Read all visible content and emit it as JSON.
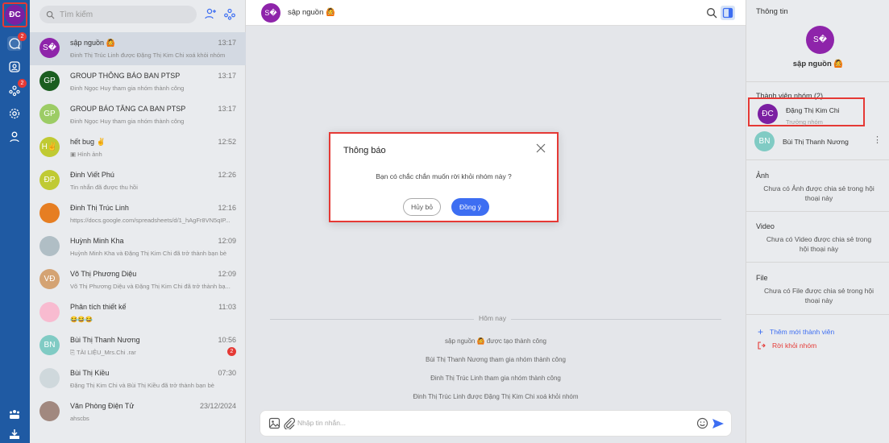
{
  "user": {
    "initials": "ĐC",
    "avatar_color": "#7b1fa2"
  },
  "rail": {
    "items": [
      {
        "name": "messages-icon",
        "badge": "2"
      },
      {
        "name": "contacts-icon",
        "badge": ""
      },
      {
        "name": "groups-icon",
        "badge": "2"
      },
      {
        "name": "settings-icon",
        "badge": ""
      },
      {
        "name": "profile-icon",
        "badge": ""
      }
    ],
    "bottom": [
      "team-icon",
      "download-icon"
    ]
  },
  "search": {
    "placeholder": "Tìm kiếm"
  },
  "conversations": [
    {
      "initials": "S�",
      "color": "#8e24aa",
      "name": "sập nguồn 🙆",
      "time": "13:17",
      "preview": "Đinh Thị Trúc Linh được Đặng Thị Kim Chi xoá khỏi nhóm",
      "selected": true
    },
    {
      "initials": "GP",
      "color": "#1b5e20",
      "name": "GROUP THÔNG BÁO BAN PTSP",
      "time": "13:17",
      "preview": "Đinh Ngọc Huy tham gia nhóm thành công"
    },
    {
      "initials": "GP",
      "color": "#9ccc65",
      "name": "GROUP BÁO TĂNG CA BAN PTSP",
      "time": "13:17",
      "preview": "Đinh Ngọc Huy tham gia nhóm thành công"
    },
    {
      "initials": "H✌",
      "color": "#c0ca33",
      "name": "hết bug ✌",
      "time": "12:52",
      "preview": "Hình ảnh",
      "preview_icon": "image-icon"
    },
    {
      "initials": "ĐP",
      "color": "#c0ca33",
      "name": "Đinh Viết Phú",
      "time": "12:26",
      "preview": "Tin nhắn đã được thu hồi"
    },
    {
      "initials": "",
      "color": "#e67e22",
      "name": "Đinh Thị Trúc Linh",
      "time": "12:16",
      "preview": "https://docs.google.com/spreadsheets/d/1_hAgFr8VN5qIP...",
      "photo": true
    },
    {
      "initials": "",
      "color": "#b0bec5",
      "name": "Huỳnh Minh Kha",
      "time": "12:09",
      "preview": "Huỳnh Minh Kha và Đặng Thị Kim Chi đã trở thành bạn bè",
      "photo": true
    },
    {
      "initials": "VĐ",
      "color": "#d4a373",
      "name": "Võ Thị Phương Diệu",
      "time": "12:09",
      "preview": "Võ Thị Phương Diệu và Đặng Thị Kim Chi đã trở thành bạ..."
    },
    {
      "initials": "",
      "color": "#f8bbd0",
      "name": "Phân tích thiết kế",
      "time": "11:03",
      "preview": "😂😂😂",
      "photo": true
    },
    {
      "initials": "BN",
      "color": "#80cbc4",
      "name": "Bùi Thị Thanh Nương",
      "time": "10:56",
      "preview": "TÀI LIỆU_Mrs.Chi .rar",
      "preview_icon": "attachment-icon",
      "badge": "2"
    },
    {
      "initials": "",
      "color": "#cfd8dc",
      "name": "Bùi Thị Kiều",
      "time": "07:30",
      "preview": "Đặng Thị Kim Chi và Bùi Thị Kiều đã trở thành bạn bè",
      "photo": true
    },
    {
      "initials": "",
      "color": "#a1887f",
      "name": "Văn Phòng Điện Tử",
      "time": "23/12/2024",
      "preview": "ahscbs",
      "photo": true
    }
  ],
  "chat": {
    "header": {
      "initials": "S�",
      "title": "sập nguồn 🙆"
    },
    "divider_label": "Hôm nay",
    "system_messages": [
      "sập nguồn 🙆 được tạo thành công",
      "Bùi Thị Thanh Nương tham gia nhóm thành công",
      "Đinh Thị Trúc Linh tham gia nhóm thành công",
      "Đinh Thị Trúc Linh được Đặng Thị Kim Chi xoá khỏi nhóm"
    ],
    "composer": {
      "placeholder": "Nhập tin nhắn..."
    }
  },
  "info": {
    "title": "Thông tin",
    "group_initials": "S�",
    "group_name": "sập nguồn 🙆",
    "members_label": "Thành viên nhóm (2)",
    "members": [
      {
        "initials": "ĐC",
        "color": "#7b1fa2",
        "name": "Đặng Thị Kim Chi",
        "role": "Trưởng nhóm"
      },
      {
        "initials": "BN",
        "color": "#80cbc4",
        "name": "Bùi Thị Thanh Nương",
        "role": ""
      }
    ],
    "photo_label": "Ảnh",
    "photo_empty": "Chưa có Ảnh được chia sẻ trong hội thoại này",
    "video_label": "Video",
    "video_empty": "Chưa có Video được chia sẻ trong hội thoại này",
    "file_label": "File",
    "file_empty": "Chưa có File được chia sẻ trong hội thoại này",
    "add_member": "Thêm mới thành viên",
    "leave_group": "Rời khỏi nhóm"
  },
  "modal": {
    "title": "Thông báo",
    "message": "Bạn có chắc chắn muốn rời khỏi nhóm này ?",
    "cancel": "Hủy bỏ",
    "confirm": "Đồng ý"
  },
  "colors": {
    "rail": "#1f5aa3",
    "accent": "#3d6ef2",
    "danger": "#e53935"
  }
}
